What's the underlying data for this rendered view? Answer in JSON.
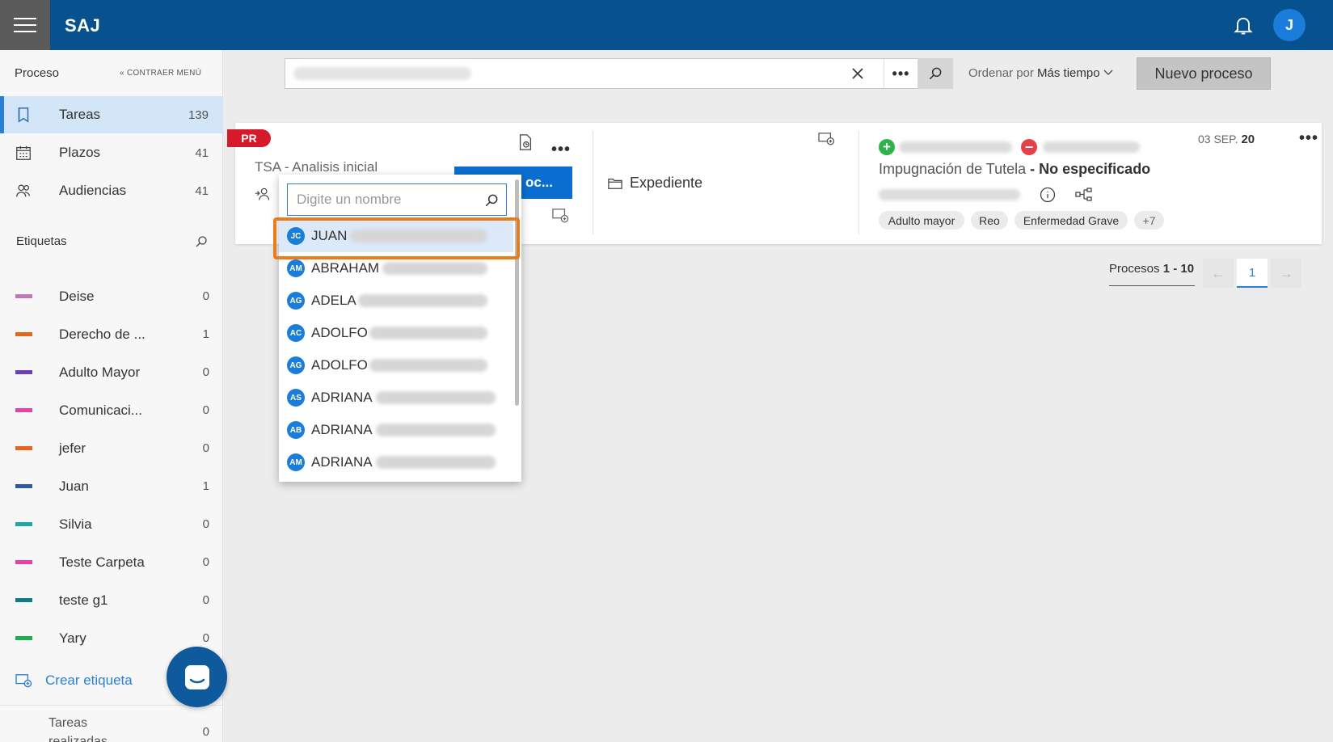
{
  "header": {
    "app_title": "SAJ",
    "user_initial": "J"
  },
  "sidebar": {
    "section_title": "Proceso",
    "collapse_label": "CONTRAER MENÚ",
    "nav": [
      {
        "label": "Tareas",
        "count": "139",
        "icon": "book-icon"
      },
      {
        "label": "Plazos",
        "count": "41",
        "icon": "calendar-icon"
      },
      {
        "label": "Audiencias",
        "count": "41",
        "icon": "people-icon"
      }
    ],
    "labels_title": "Etiquetas",
    "labels": [
      {
        "label": "Deise",
        "count": "0",
        "color": "#c278b6"
      },
      {
        "label": "Derecho de ...",
        "count": "1",
        "color": "#e8641a"
      },
      {
        "label": "Adulto Mayor",
        "count": "0",
        "color": "#6a3fb5"
      },
      {
        "label": "Comunicaci...",
        "count": "0",
        "color": "#ea3ea8"
      },
      {
        "label": "jefer",
        "count": "0",
        "color": "#e8641a"
      },
      {
        "label": "Juan",
        "count": "1",
        "color": "#2d5aa8"
      },
      {
        "label": "Silvia",
        "count": "0",
        "color": "#1fa6a6"
      },
      {
        "label": "Teste Carpeta",
        "count": "0",
        "color": "#ea3ea8"
      },
      {
        "label": "teste g1",
        "count": "0",
        "color": "#127a85"
      },
      {
        "label": "Yary",
        "count": "0",
        "color": "#1fae4c"
      }
    ],
    "create_label": "Crear etiqueta",
    "done_label": "Tareas realizadas",
    "done_count": "0"
  },
  "toolbar": {
    "sort_prefix": "Ordenar por",
    "sort_value": "Más tiempo",
    "new_process": "Nuevo proceso"
  },
  "card": {
    "badge": "PR",
    "task_title": "TSA - Analisis inicial",
    "action_button": "oc...",
    "expediente": "Expediente",
    "date_prefix": "03 SEP.",
    "date_year": "20",
    "case_title": "Impugnación de Tutela",
    "case_sep": " - ",
    "case_status": "No especificado",
    "chips": [
      "Adulto mayor",
      "Reo",
      "Enfermedad Grave",
      "+7"
    ]
  },
  "pagination": {
    "prefix": "Procesos",
    "range": "1 - 10",
    "current": "1"
  },
  "dropdown": {
    "placeholder": "Digite un nombre",
    "items": [
      {
        "initials": "JC",
        "name": "JUAN"
      },
      {
        "initials": "AM",
        "name": "ABRAHAM"
      },
      {
        "initials": "AG",
        "name": "ADELA"
      },
      {
        "initials": "AC",
        "name": "ADOLFO"
      },
      {
        "initials": "AG",
        "name": "ADOLFO"
      },
      {
        "initials": "AS",
        "name": "ADRIANA"
      },
      {
        "initials": "AB",
        "name": "ADRIANA"
      },
      {
        "initials": "AM",
        "name": "ADRIANA"
      }
    ]
  }
}
